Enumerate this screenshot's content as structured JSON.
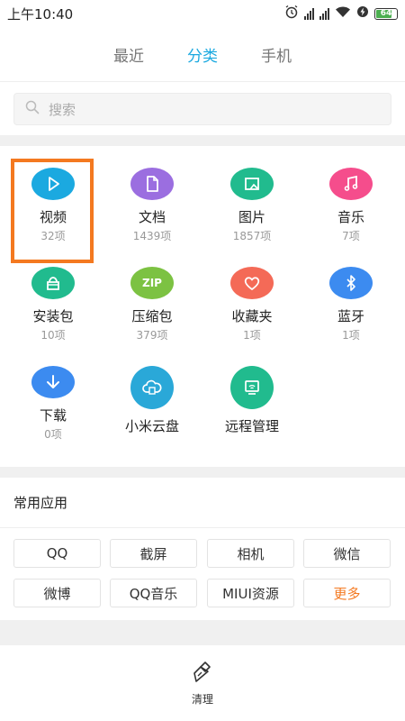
{
  "status": {
    "time": "上午10:40",
    "battery": "64"
  },
  "tabs": [
    {
      "label": "最近",
      "active": false
    },
    {
      "label": "分类",
      "active": true
    },
    {
      "label": "手机",
      "active": false
    }
  ],
  "search": {
    "placeholder": "搜索"
  },
  "categories": [
    {
      "label": "视频",
      "count": "32项",
      "icon": "play-icon",
      "color": "#1ba9e0"
    },
    {
      "label": "文档",
      "count": "1439项",
      "icon": "document-icon",
      "color": "#9b6ee0"
    },
    {
      "label": "图片",
      "count": "1857项",
      "icon": "image-icon",
      "color": "#21bb8e"
    },
    {
      "label": "音乐",
      "count": "7项",
      "icon": "music-icon",
      "color": "#f54d8c"
    },
    {
      "label": "安装包",
      "count": "10项",
      "icon": "package-icon",
      "color": "#21bb8e"
    },
    {
      "label": "压缩包",
      "count": "379项",
      "icon": "zip-icon",
      "color": "#7cc242",
      "badge": "ZIP"
    },
    {
      "label": "收藏夹",
      "count": "1项",
      "icon": "heart-icon",
      "color": "#f46a57"
    },
    {
      "label": "蓝牙",
      "count": "1项",
      "icon": "bluetooth-icon",
      "color": "#3c8bf0"
    },
    {
      "label": "下载",
      "count": "0项",
      "icon": "download-icon",
      "color": "#3c8bf0"
    },
    {
      "label": "小米云盘",
      "count": "",
      "icon": "cloud-icon",
      "color": "#2aa8d8"
    },
    {
      "label": "远程管理",
      "count": "",
      "icon": "remote-icon",
      "color": "#21bb8e"
    }
  ],
  "common_apps": {
    "title": "常用应用",
    "items": [
      "QQ",
      "截屏",
      "相机",
      "微信",
      "微博",
      "QQ音乐",
      "MIUI资源",
      "更多"
    ]
  },
  "bottom": {
    "clean_label": "清理"
  }
}
